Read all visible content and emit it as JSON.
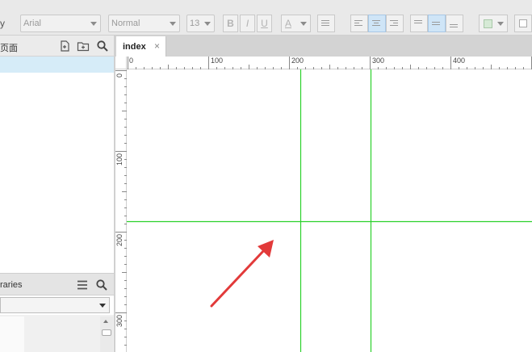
{
  "toolbar": {
    "font_family": "Arial",
    "font_style": "Normal",
    "font_size": "13",
    "bold": "B",
    "italic": "I",
    "underline": "U",
    "text_color": "A"
  },
  "pages_panel": {
    "title": "页面"
  },
  "libraries_panel": {
    "title": "raries"
  },
  "document_tab": {
    "label": "index",
    "close": "×"
  },
  "ruler": {
    "horizontal_labels": [
      "0",
      "100",
      "200",
      "300",
      "400"
    ],
    "vertical_labels": [
      "0",
      "100",
      "200",
      "300"
    ]
  },
  "colors": {
    "guide_line": "#2bd12b",
    "arrow": "#e23a3a",
    "selection": "#d6ecf8"
  },
  "icons": [
    "add-page-icon",
    "add-folder-icon",
    "search-icon",
    "menu-icon",
    "search-icon",
    "close-icon",
    "arrow-icon"
  ]
}
